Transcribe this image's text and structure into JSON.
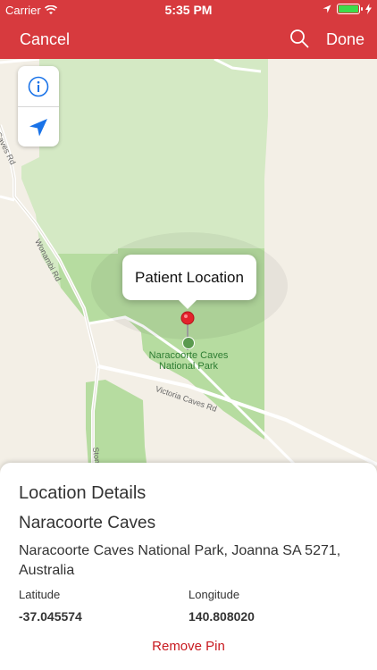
{
  "status_bar": {
    "carrier": "Carrier",
    "time": "5:35 PM",
    "wifi_icon": "wifi-icon",
    "location_icon": "location-arrow-icon",
    "battery_icon": "battery-charging-icon",
    "battery_color": "#3ddc4a"
  },
  "nav": {
    "cancel_label": "Cancel",
    "done_label": "Done",
    "search_icon": "search-icon",
    "background": "#d73a3e"
  },
  "map": {
    "callout_title": "Patient Location",
    "park_label": "Naracoorte Caves National Park",
    "road_labels": {
      "caves_rd": "Caves Rd",
      "wonambi_rd": "Wonambi Rd",
      "victoria_caves_rd": "Victoria Caves Rd",
      "ston": "Ston"
    },
    "controls": {
      "info_icon": "info-icon",
      "locate_icon": "location-arrow-icon"
    }
  },
  "details": {
    "title": "Location Details",
    "place_name": "Naracoorte Caves",
    "address": "Naracoorte Caves National Park, Joanna SA 5271, Australia",
    "latitude_label": "Latitude",
    "latitude_value": "-37.045574",
    "longitude_label": "Longitude",
    "longitude_value": "140.808020",
    "remove_label": "Remove Pin",
    "accent_color": "#c8191f"
  }
}
